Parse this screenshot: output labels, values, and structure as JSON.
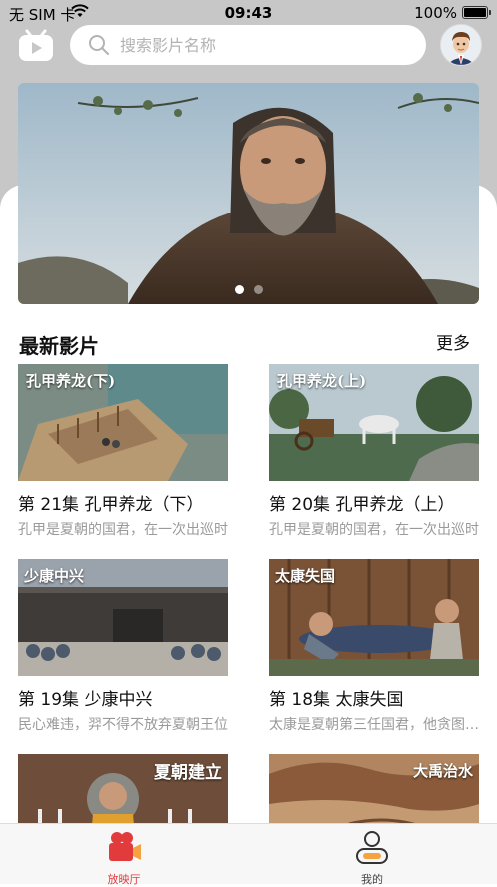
{
  "status_bar": {
    "carrier": "无 SIM 卡",
    "time": "09:43",
    "battery": "100%"
  },
  "header": {
    "logo_icon": "play-tv-icon",
    "search_placeholder": "搜索影片名称",
    "avatar_icon": "user-avatar"
  },
  "banner": {
    "slide_count": 2,
    "active_slide": 1
  },
  "section": {
    "title": "最新影片",
    "more_label": "更多"
  },
  "videos": [
    {
      "title": "第 21集 孔甲养龙（下）",
      "desc": "孔甲是夏朝的国君，在一次出巡时",
      "thumb_label": "孔甲养龙(下)"
    },
    {
      "title": "第 20集 孔甲养龙（上）",
      "desc": "孔甲是夏朝的国君，在一次出巡时",
      "thumb_label": "孔甲养龙(上)"
    },
    {
      "title": "第 19集 少康中兴",
      "desc": "民心难违，羿不得不放弃夏朝王位",
      "thumb_label": "少康中兴"
    },
    {
      "title": "第 18集 太康失国",
      "desc": "太康是夏朝第三任国君，他贪图享乐",
      "thumb_label": "太康失国"
    },
    {
      "title": "",
      "desc": "",
      "thumb_label": "夏朝建立"
    },
    {
      "title": "",
      "desc": "",
      "thumb_label": "大禹治水"
    }
  ],
  "tabbar": {
    "tabs": [
      {
        "label": "放映厅",
        "icon": "camera-icon",
        "active": true
      },
      {
        "label": "我的",
        "icon": "person-icon",
        "active": false
      }
    ]
  },
  "colors": {
    "accent": "#e23b3b",
    "header_bg": "#c7c7c7"
  }
}
